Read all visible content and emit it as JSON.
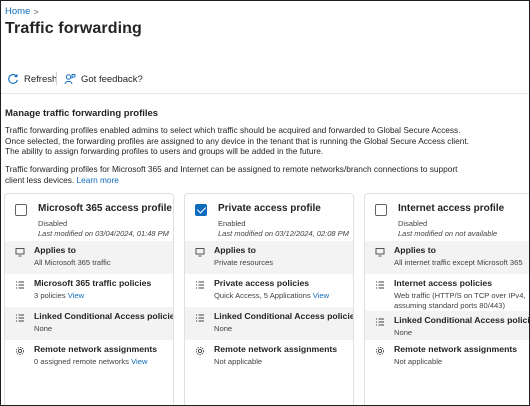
{
  "breadcrumb": {
    "home": "Home",
    "separator": ">"
  },
  "page": {
    "title": "Traffic forwarding",
    "more": "..."
  },
  "toolbar": {
    "refresh_label": "Refresh",
    "feedback_label": "Got feedback?"
  },
  "manage": {
    "heading": "Manage traffic forwarding profiles",
    "desc1_line1": "Traffic forwarding profiles enabled admins to select which traffic should be acquired and forwarded to Global Secure Access.",
    "desc1_line2": "Once selected, the forwarding profiles are assigned to any device in the tenant that is running the Global Secure Access client.",
    "desc1_line3": "The ability to assign forwarding profiles to users and groups will be added in the future.",
    "desc2_line1": "Traffic forwarding profiles for Microsoft 365 and Internet can be assigned to remote networks/branch connections to support",
    "desc2_line2": "client less devices.",
    "learn_more": "Learn more"
  },
  "cards": [
    {
      "title": "Microsoft 365 access profile",
      "checked": false,
      "status": "Disabled",
      "modified": "Last modified on 03/04/2024, 01:48 PM",
      "applies_label": "Applies to",
      "applies_value": "All Microsoft 365 traffic",
      "policies_label": "Microsoft 365 traffic policies",
      "policies_value": "3 policies",
      "policies_link": "View",
      "ca_label": "Linked Conditional Access policies",
      "ca_value": "None",
      "remote_label": "Remote network assignments",
      "remote_value": "0 assigned remote networks",
      "remote_link": "View"
    },
    {
      "title": "Private access profile",
      "checked": true,
      "status": "Enabled",
      "modified": "Last modified on 03/12/2024, 02:08 PM",
      "applies_label": "Applies to",
      "applies_value": "Private resources",
      "policies_label": "Private access policies",
      "policies_value": "Quick Access, 5 Applications",
      "policies_link": "View",
      "ca_label": "Linked Conditional Access policies",
      "ca_value": "None",
      "remote_label": "Remote network assignments",
      "remote_value": "Not applicable",
      "remote_link": ""
    },
    {
      "title": "Internet access profile",
      "checked": false,
      "status": "Disabled",
      "modified": "Last modified on not available",
      "applies_label": "Applies to",
      "applies_value": "All internet traffic except Microsoft 365",
      "policies_label": "Internet access policies",
      "policies_value": "Web traffic (HTTP/S on TCP over IPv4,",
      "policies_value2": "assuming standard ports 80/443)",
      "policies_link": "",
      "ca_label": "Linked Conditional Access policies",
      "ca_value": "None",
      "remote_label": "Remote network assignments",
      "remote_value": "Not applicable",
      "remote_link": ""
    }
  ]
}
